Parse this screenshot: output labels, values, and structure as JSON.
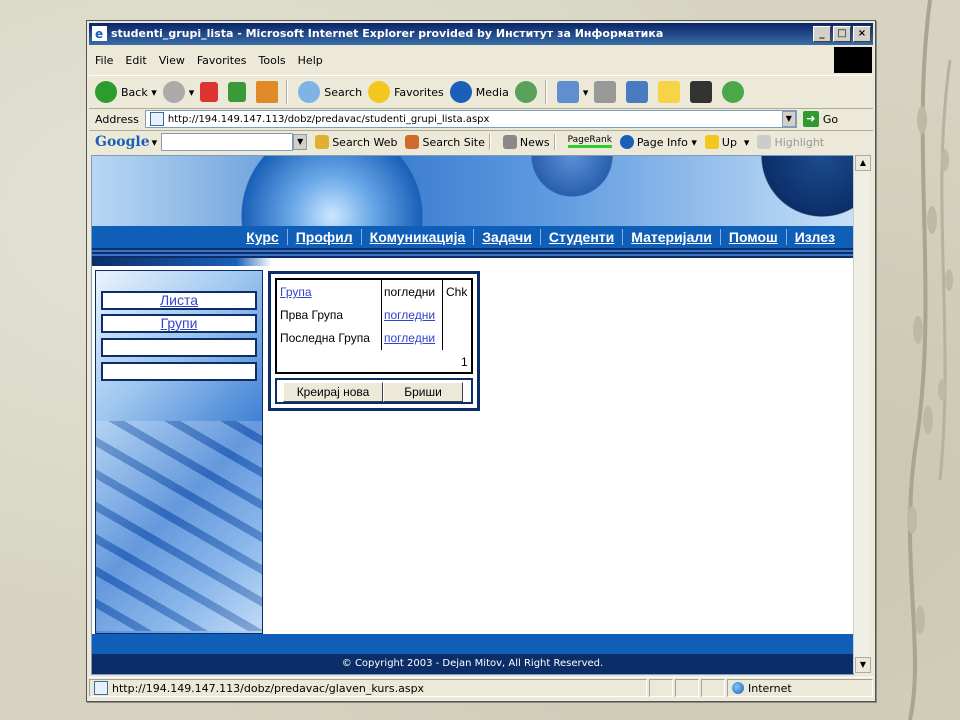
{
  "window": {
    "title": "studenti_grupi_lista - Microsoft Internet Explorer provided by Институт за Информатика"
  },
  "menu": [
    "File",
    "Edit",
    "View",
    "Favorites",
    "Tools",
    "Help"
  ],
  "toolbar": {
    "back": "Back",
    "search": "Search",
    "favorites": "Favorites",
    "media": "Media"
  },
  "address": {
    "label": "Address",
    "url": "http://194.149.147.113/dobz/predavac/studenti_grupi_lista.aspx",
    "go": "Go"
  },
  "googlebar": {
    "logo": "Google",
    "search_web": "Search Web",
    "search_site": "Search Site",
    "news": "News",
    "pagerank": "PageRank",
    "page_info": "Page Info",
    "up": "Up",
    "highlight": "Highlight"
  },
  "nav": [
    "Курс",
    "Профил",
    "Комуникација",
    "Задачи",
    "Студенти",
    "Материјали",
    "Помош",
    "Излез"
  ],
  "sidebar": {
    "items": [
      "Листа",
      "Групи",
      "",
      ""
    ]
  },
  "table": {
    "headers": [
      "Група",
      "погледни",
      "Chk"
    ],
    "rows": [
      {
        "name": "Прва Група",
        "link": "погледни"
      },
      {
        "name": "Последна Група",
        "link": "погледни"
      }
    ],
    "page": "1"
  },
  "buttons": {
    "create": "Креирај нова",
    "delete": "Бриши"
  },
  "footer": {
    "copyright": "© Copyright 2003 - Dejan Mitov, All Right Reserved."
  },
  "status": {
    "url": "http://194.149.147.113/dobz/predavac/glaven_kurs.aspx",
    "zone": "Internet"
  },
  "colors": {
    "title_gradient_start": "#0a246a",
    "nav_blue": "#0f5fb9",
    "dark_blue": "#0b2e68",
    "link": "#3344cc"
  }
}
